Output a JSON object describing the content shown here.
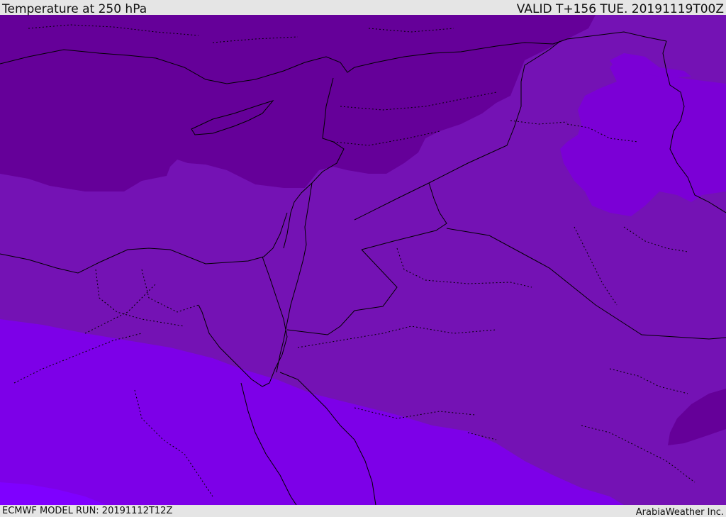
{
  "header": {
    "title": "Temperature at 250 hPa",
    "valid": "VALID T+156 TUE. 20191119T00Z"
  },
  "footer": {
    "model_run": "ECMWF MODEL RUN: 20191112T12Z",
    "credit": "ArabiaWeather Inc."
  },
  "colors": {
    "band_coldest": "#650099",
    "band_cold": "#7412b4",
    "band_mid": "#7b00d6",
    "band_warm": "#7d00e8",
    "band_warmest": "#7f00ff",
    "border": "#000000"
  }
}
